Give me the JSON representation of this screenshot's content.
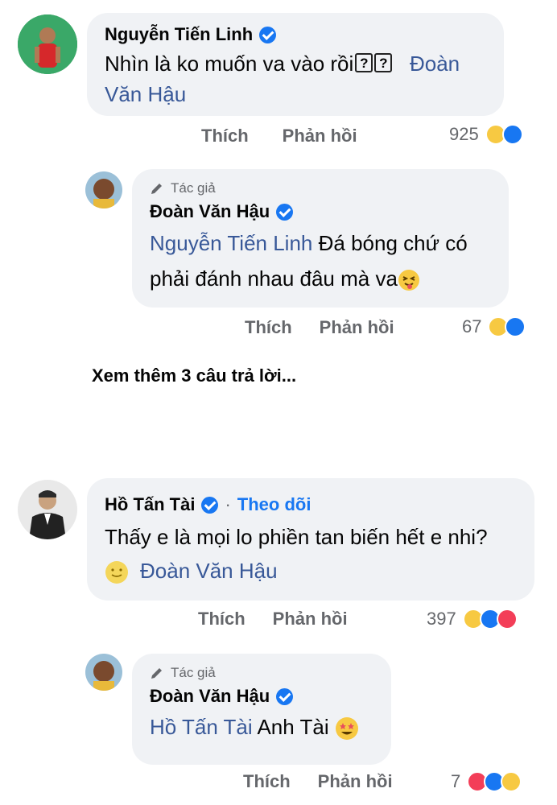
{
  "comments": [
    {
      "name": "Nguyễn Tiến Linh",
      "text_1": "Nhìn là ko muốn va vào rồi",
      "qbox": "?",
      "mention": "Đoàn",
      "text_2": "Văn Hậu",
      "actions": {
        "like": "Thích",
        "reply": "Phản hồi"
      },
      "count": "925",
      "reactions": [
        "haha",
        "like"
      ]
    },
    {
      "author_tag": "Tác giả",
      "name": "Đoàn Văn Hậu",
      "mention": "Nguyễn Tiến Linh",
      "text_1": "Đá bóng chứ có",
      "text_2": "phải đánh nhau đâu mà va",
      "actions": {
        "like": "Thích",
        "reply": "Phản hồi"
      },
      "count": "67",
      "reactions": [
        "haha",
        "like"
      ]
    },
    {
      "name": "Hồ Tấn Tài",
      "dot": "·",
      "follow": "Theo dõi",
      "text_1": "Thấy e là mọi lo phiền tan biến hết e nhi?",
      "mention": "Đoàn Văn Hậu",
      "actions": {
        "like": "Thích",
        "reply": "Phản hồi"
      },
      "count": "397",
      "reactions": [
        "haha",
        "like",
        "love"
      ]
    },
    {
      "author_tag": "Tác giả",
      "name": "Đoàn Văn Hậu",
      "mention": "Hồ Tấn Tài",
      "text_1": "Anh Tài",
      "actions": {
        "like": "Thích",
        "reply": "Phản hồi"
      },
      "count": "7",
      "reactions": [
        "love",
        "like",
        "haha"
      ]
    }
  ],
  "more_replies": "Xem thêm 3 câu trả lời...",
  "colors": {
    "bubble": "#f0f2f5",
    "mention": "#385898",
    "verified": "#1877f2",
    "muted": "#65676b"
  }
}
